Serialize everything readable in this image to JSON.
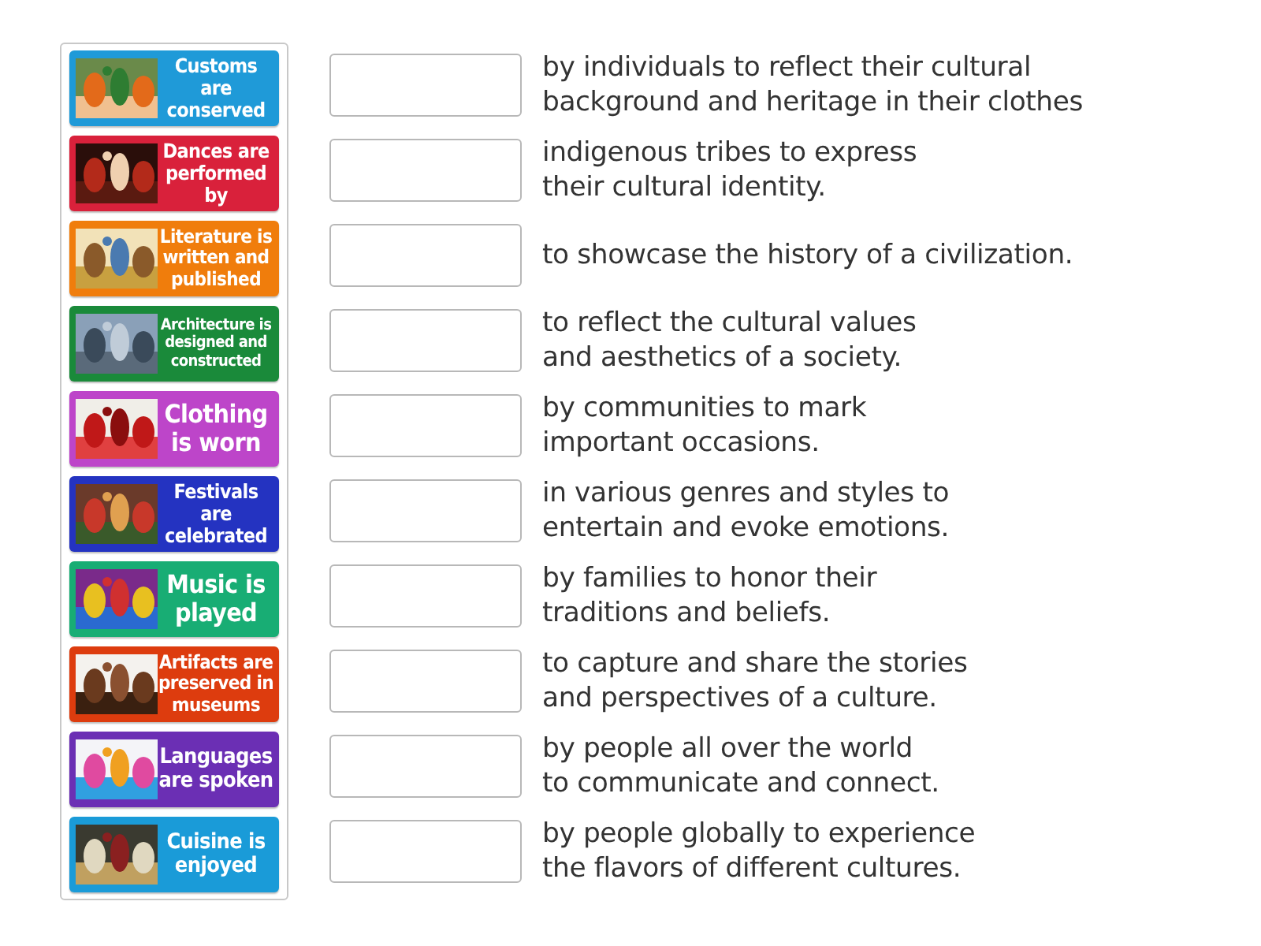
{
  "tiles": [
    {
      "label": "Customs are conserved",
      "color": "#1f9ad8"
    },
    {
      "label": "Dances are performed by",
      "color": "#d9213b"
    },
    {
      "label": "Literature is written and published",
      "color": "#f07d0c"
    },
    {
      "label": "Architecture is designed and constructed",
      "color": "#1a8a3a"
    },
    {
      "label": "Clothing is worn",
      "color": "#bd45c9"
    },
    {
      "label": "Festivals are celebrated",
      "color": "#2433c1"
    },
    {
      "label": "Music is played",
      "color": "#18ad74"
    },
    {
      "label": "Artifacts are preserved in museums",
      "color": "#dd3c0e"
    },
    {
      "label": "Languages are spoken",
      "color": "#6b2fb4"
    },
    {
      "label": "Cuisine is enjoyed",
      "color": "#1a9bd8"
    }
  ],
  "answers": [
    {
      "text": "by individuals to reflect their cultural\nbackground and heritage in their clothes"
    },
    {
      "text": "indigenous tribes to express\ntheir cultural identity."
    },
    {
      "text": "to showcase the history of a civilization."
    },
    {
      "text": "to reflect the cultural values\nand aesthetics of a society."
    },
    {
      "text": "by communities to mark\nimportant occasions."
    },
    {
      "text": "in various genres and styles to\nentertain and evoke emotions."
    },
    {
      "text": "by families to honor their\ntraditions and beliefs."
    },
    {
      "text": "to capture and share the stories\nand perspectives of a culture."
    },
    {
      "text": "by people all over the world\nto communicate and connect."
    },
    {
      "text": "by people globally to experience\nthe flavors of different cultures."
    }
  ]
}
